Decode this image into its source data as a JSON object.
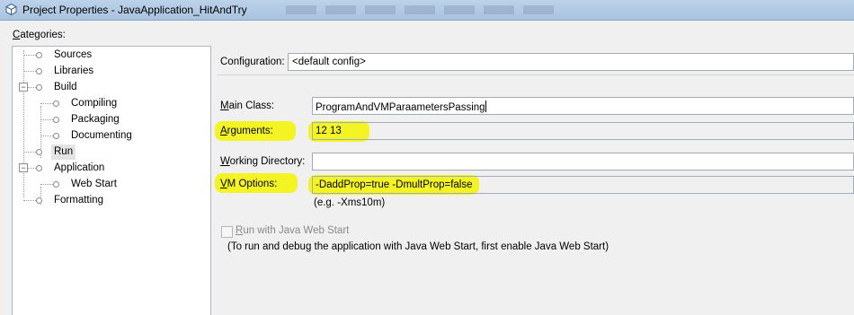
{
  "window": {
    "title": "Project Properties - JavaApplication_HitAndTry",
    "icon": "netbeans-cube-icon"
  },
  "categories": {
    "label_prefix": "C",
    "label_rest": "ategories:",
    "items": [
      {
        "label": "Sources"
      },
      {
        "label": "Libraries"
      },
      {
        "label": "Build"
      },
      {
        "label": "Compiling"
      },
      {
        "label": "Packaging"
      },
      {
        "label": "Documenting"
      },
      {
        "label": "Run",
        "selected": true
      },
      {
        "label": "Application"
      },
      {
        "label": "Web Start"
      },
      {
        "label": "Formatting"
      }
    ]
  },
  "run": {
    "configuration_label": "Configuration:",
    "configuration_value": "<default config>",
    "main_class_prefix": "M",
    "main_class_rest": "ain Class:",
    "main_class_value": "ProgramAndVMParaametersPassing",
    "arguments_prefix": "A",
    "arguments_rest": "rguments:",
    "arguments_value": "12 13",
    "working_dir_prefix": "W",
    "working_dir_rest": "orking Directory:",
    "working_dir_value": "",
    "vm_options_prefix": "V",
    "vm_options_rest": "M Options:",
    "vm_options_value": "-DaddProp=true  -DmultProp=false",
    "vm_options_hint": "(e.g. -Xms10m)",
    "web_start_checkbox_prefix": "R",
    "web_start_checkbox_rest": "un with Java Web Start",
    "web_start_checked": false,
    "web_start_note": "(To run and debug the application with Java Web Start, first enable Java Web Start)"
  },
  "colors": {
    "highlight": "#f4f400",
    "titlebar": "#b3cae6"
  }
}
